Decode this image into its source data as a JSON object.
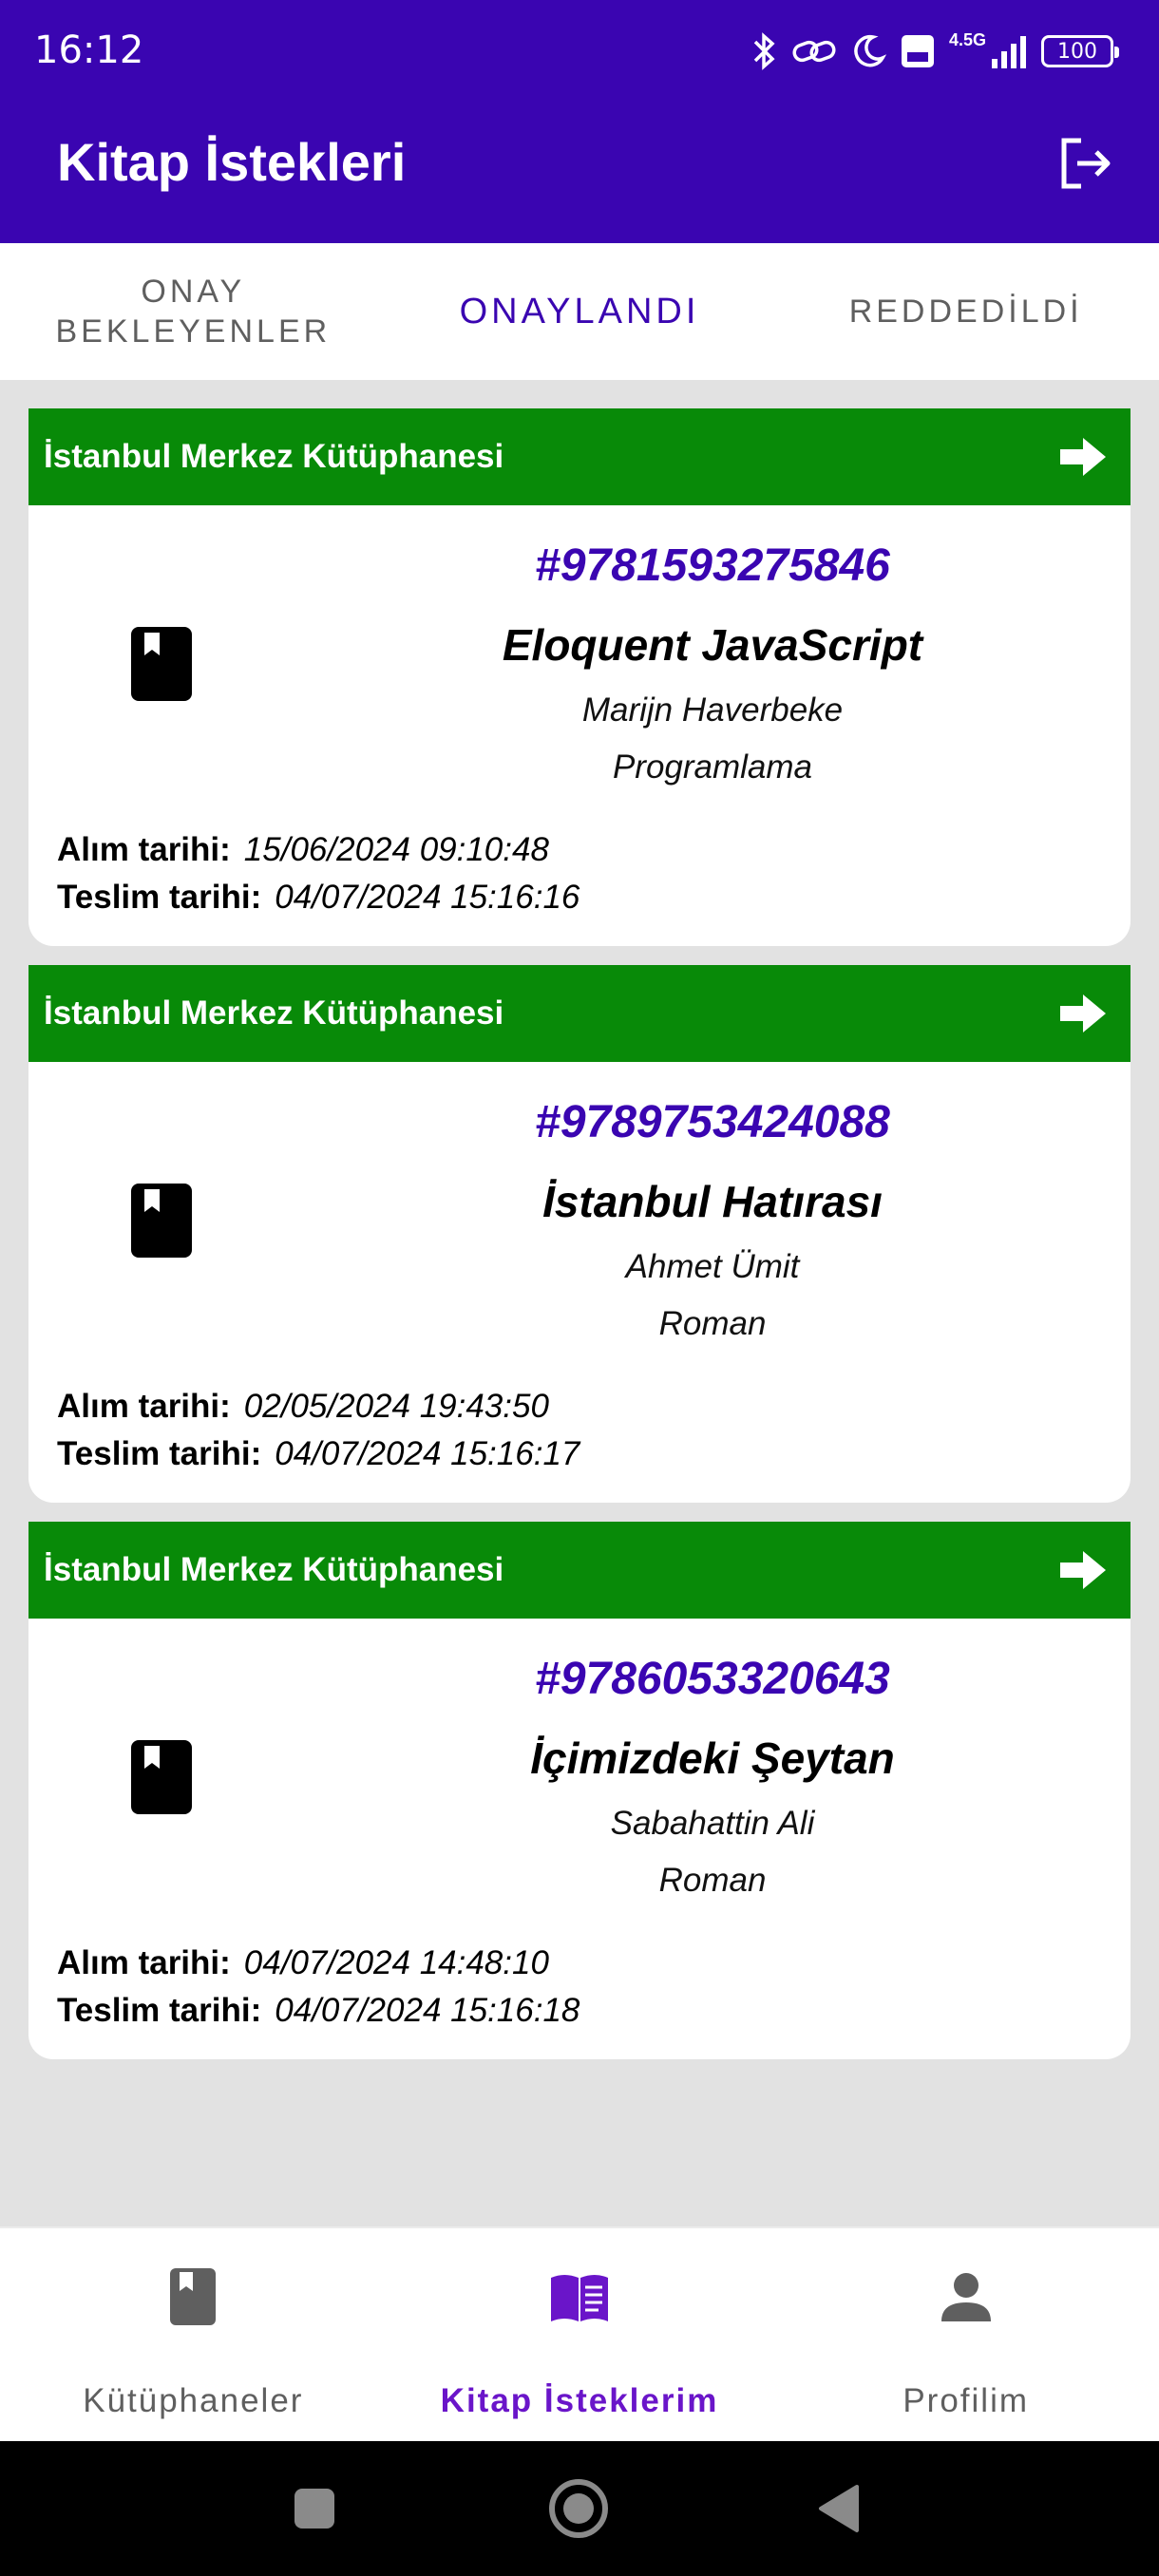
{
  "status_bar": {
    "time": "16:12",
    "network_label": "4.5G",
    "battery": "100",
    "colors": {
      "bg": "#3a05b1"
    }
  },
  "app_bar": {
    "title": "Kitap İstekleri",
    "action_icon": "logout-icon"
  },
  "tabs": [
    {
      "label": "ONAY\nBEKLEYENLER",
      "active": false
    },
    {
      "label": "ONAYLANDI",
      "active": true
    },
    {
      "label": "REDDEDİLDİ",
      "active": false
    }
  ],
  "requests": [
    {
      "library": "İstanbul Merkez Kütüphanesi",
      "isbn": "#9781593275846",
      "title": "Eloquent JavaScript",
      "author": "Marijn Haverbeke",
      "genre": "Programlama",
      "pickup_label": "Alım tarihi:",
      "pickup_date": "15/06/2024 09:10:48",
      "return_label": "Teslim tarihi:",
      "return_date": "04/07/2024 15:16:16"
    },
    {
      "library": "İstanbul Merkez Kütüphanesi",
      "isbn": "#9789753424088",
      "title": "İstanbul Hatırası",
      "author": "Ahmet Ümit",
      "genre": "Roman",
      "pickup_label": "Alım tarihi:",
      "pickup_date": "02/05/2024 19:43:50",
      "return_label": "Teslim tarihi:",
      "return_date": "04/07/2024 15:16:17"
    },
    {
      "library": "İstanbul Merkez Kütüphanesi",
      "isbn": "#9786053320643",
      "title": "İçimizdeki Şeytan",
      "author": "Sabahattin Ali",
      "genre": "Roman",
      "pickup_label": "Alım tarihi:",
      "pickup_date": "04/07/2024 14:48:10",
      "return_label": "Teslim tarihi:",
      "return_date": "04/07/2024 15:16:18"
    }
  ],
  "bottom_nav": [
    {
      "label": "Kütüphaneler",
      "icon": "book-icon",
      "active": false
    },
    {
      "label": "Kitap İsteklerim",
      "icon": "open-book-icon",
      "active": true
    },
    {
      "label": "Profilim",
      "icon": "person-icon",
      "active": false
    }
  ],
  "colors": {
    "primary": "#3a05b1",
    "header_green": "#088a08",
    "active_nav": "#6a15c9",
    "background": "#e2e2e2"
  }
}
